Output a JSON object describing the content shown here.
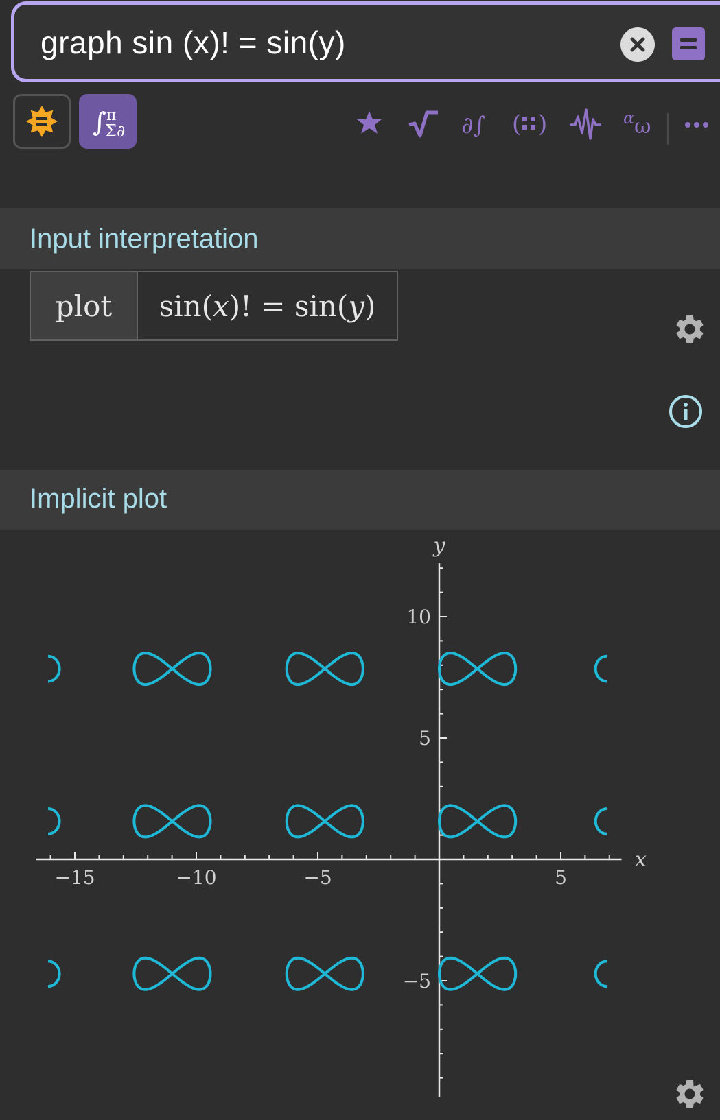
{
  "search": {
    "query": "graph sin (x)! = sin(y)"
  },
  "toolbar": {
    "icons": [
      "wolfram-sun-icon",
      "math-input-icon",
      "star-icon",
      "sqrt-icon",
      "partial-integral-icon",
      "matrix-icon",
      "waveform-icon",
      "greek-letters-icon",
      "more-icon"
    ],
    "colors": {
      "accent": "#8e70c4",
      "search_border": "#b8a6f2",
      "sun": "#f5a623"
    }
  },
  "input_interpretation": {
    "title": "Input interpretation",
    "key": "plot",
    "value_parts": [
      "sin(",
      "x",
      ")! = sin(",
      "y",
      ")"
    ]
  },
  "implicit_plot": {
    "title": "Implicit plot"
  },
  "chart_data": {
    "type": "line",
    "title": "",
    "xlabel": "x",
    "ylabel": "y",
    "xlim": [
      -16.6,
      7.5
    ],
    "ylim": [
      -9.8,
      12.2
    ],
    "x_ticks": [
      {
        "value": -15,
        "label": "−15"
      },
      {
        "value": -10,
        "label": "−10"
      },
      {
        "value": -5,
        "label": "−5"
      },
      {
        "value": 5,
        "label": "5"
      }
    ],
    "y_ticks": [
      {
        "value": 10,
        "label": "10"
      },
      {
        "value": 5,
        "label": "5"
      },
      {
        "value": -5,
        "label": "−5"
      }
    ],
    "grid": false,
    "line_color": "#1fb8d6",
    "curve": "sin(x)! = sin(y)",
    "figure_eight_centers_x": [
      -10.99,
      -4.71,
      1.57
    ],
    "figure_eight_centers_y": [
      7.85,
      1.57,
      -4.71
    ],
    "figure_eight_half_width": 1.57,
    "figure_eight_half_height": 0.52,
    "partial_left_x": -16.1,
    "partial_right_x": 6.9,
    "partial_half_height": 0.52
  }
}
